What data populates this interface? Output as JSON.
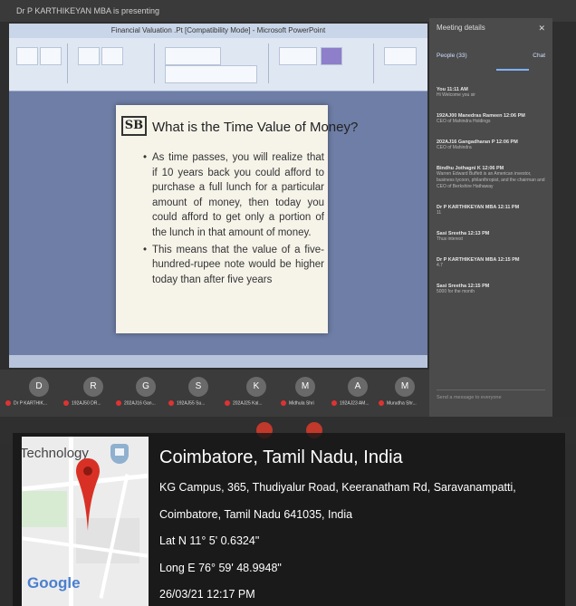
{
  "meeting": {
    "window_title": "Dr P KARTHIKEYAN MBA is presenting",
    "ppt_title": "Financial Valuation .Pt [Compatibility Mode] - Microsoft PowerPoint",
    "slide": {
      "logo_text": "SB",
      "title": "What is the Time Value of Money?",
      "bullets": [
        "As time passes, you will realize that if 10 years back you could afford to purchase a full lunch for a particular amount of money, then today you could afford to get only a portion of the lunch in that amount of money.",
        "This means that the value of a five-hundred-rupee note would be higher today than after five years"
      ]
    },
    "panel": {
      "title": "Meeting details",
      "tab_people": "People (33)",
      "tab_chat": "Chat",
      "chat": [
        {
          "name": "You 11:11 AM",
          "msg": "Hi Welcome you sir"
        },
        {
          "name": "192AJ00 Manedras Rameen 12:06 PM",
          "msg": "CEO of Mahindra Holdings"
        },
        {
          "name": "202AJ16 Gangadharan P 12:06 PM",
          "msg": "CEO of Mahindra"
        },
        {
          "name": "Bindhu Jothagni K 12:06 PM",
          "msg": "Warren Edward Buffett is an American investor, business tycoon, philanthropist, and the chairman and CEO of Berkshire Hathaway"
        },
        {
          "name": "Dr P KARTHIKEYAN MBA 12:11 PM",
          "msg": "11"
        },
        {
          "name": "Sasi Sreetha 12:13 PM",
          "msg": "Thus interest"
        },
        {
          "name": "Dr P KARTHIKEYAN MBA 12:15 PM",
          "msg": "4.7"
        },
        {
          "name": "Sasi Sreetha 12:15 PM",
          "msg": "5000 for the month"
        }
      ],
      "send_placeholder": "Send a message to everyone"
    },
    "participants": [
      {
        "initial": "D",
        "label": "Dr P KARTHIK..."
      },
      {
        "initial": "R",
        "label": "192AJ50 DR..."
      },
      {
        "initial": "G",
        "label": "202AJ16 Gan..."
      },
      {
        "initial": "S",
        "label": "192AJ55 Su..."
      },
      {
        "initial": "K",
        "label": "202AJ25 Kal..."
      },
      {
        "initial": "M",
        "label": "Midhula Shri"
      },
      {
        "initial": "A",
        "label": "192AJ23 AM..."
      },
      {
        "initial": "M",
        "label": "Murudha Shr..."
      }
    ]
  },
  "geotag": {
    "map_label": "Technology",
    "map_brand": "Google",
    "city": "Coimbatore, Tamil Nadu, India",
    "address_line1": "KG Campus, 365, Thudiyalur Road, Keeranatham Rd, Saravanampatti,",
    "address_line2": "Coimbatore, Tamil Nadu 641035, India",
    "lat": "Lat N 11° 5' 0.6324\"",
    "long": "Long E 76° 59' 48.9948\"",
    "datetime": "26/03/21 12:17 PM",
    "pin_color": "#d93025"
  }
}
